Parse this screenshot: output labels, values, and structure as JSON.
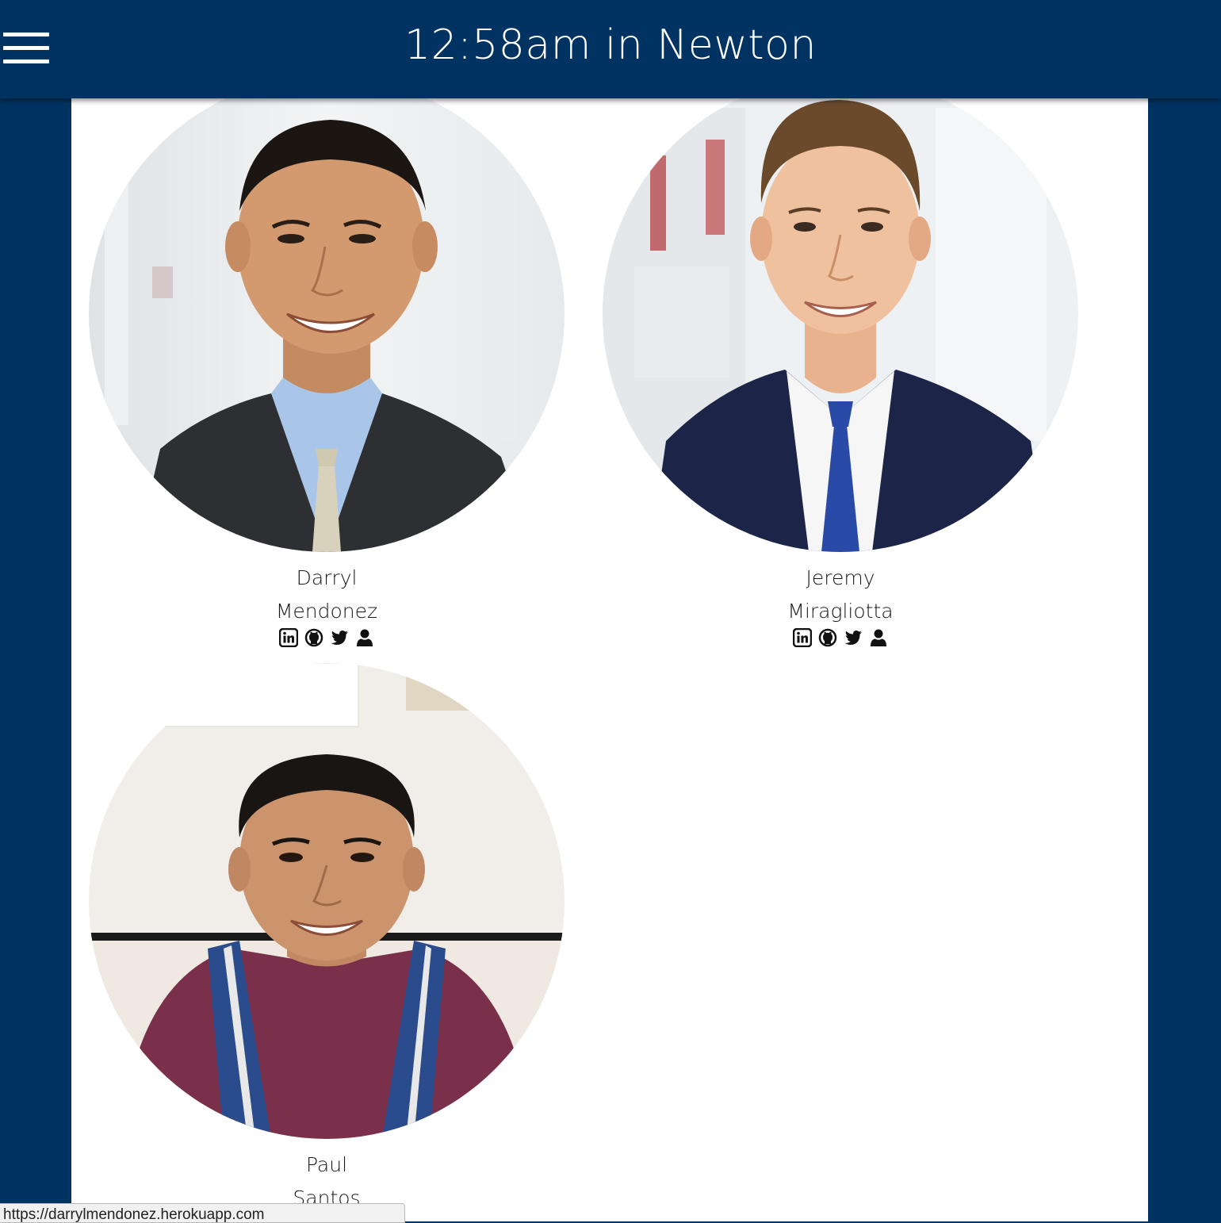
{
  "header": {
    "title": "12:58am in Newton",
    "menu_icon": "hamburger-menu-icon"
  },
  "team": [
    {
      "first_name": "Darryl",
      "last_name": "Mendonez",
      "icons": [
        "linkedin-icon",
        "github-icon",
        "twitter-icon",
        "user-profile-icon"
      ]
    },
    {
      "first_name": "Jeremy",
      "last_name": "Miragliotta",
      "icons": [
        "linkedin-icon",
        "github-icon",
        "twitter-icon",
        "user-profile-icon"
      ]
    },
    {
      "first_name": "Paul",
      "last_name": "Santos"
    }
  ],
  "status_bar": {
    "url": "https://darrylmendonez.herokuapp.com"
  },
  "colors": {
    "brand_navy": "#003362",
    "panel_bg": "#ffffff",
    "text": "#1a1a1a"
  }
}
